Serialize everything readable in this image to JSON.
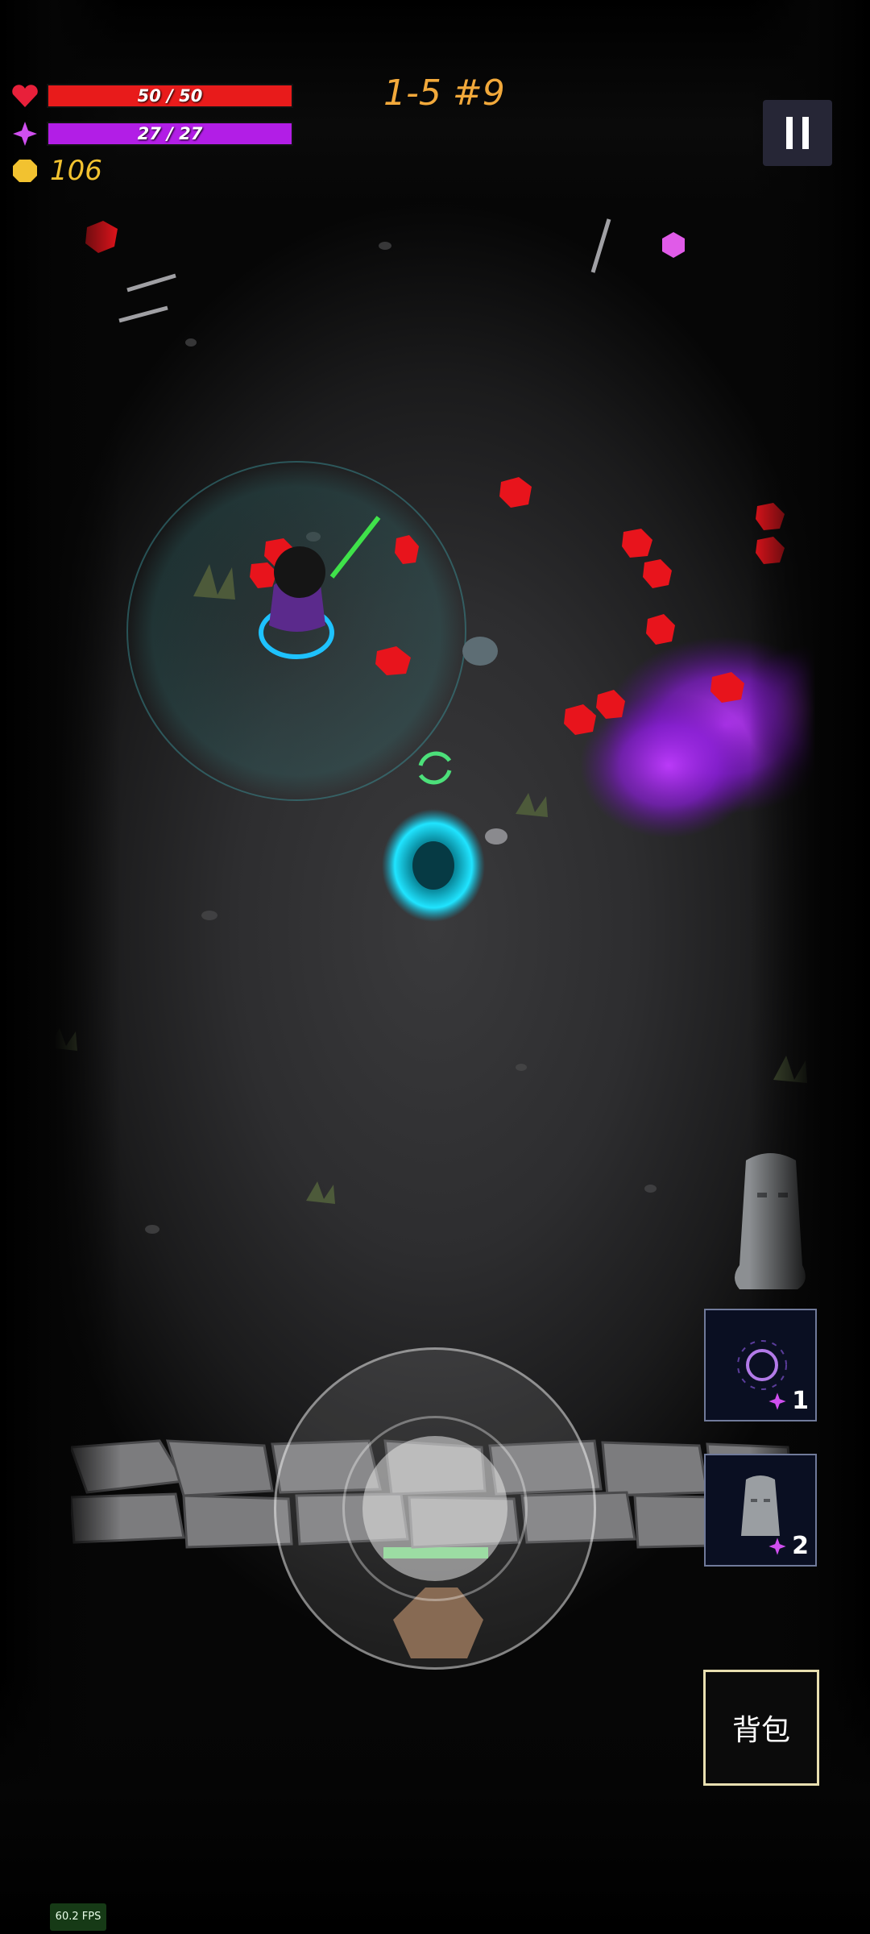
{
  "hud": {
    "health": {
      "label": "50 / 50",
      "current": 50,
      "max": 50,
      "color": "#e81b1b"
    },
    "mana": {
      "label": "27 / 27",
      "current": 27,
      "max": 27,
      "color": "#b21ee6"
    },
    "gold": {
      "value": "106",
      "color": "#f2c230"
    },
    "level": "1-5 #9"
  },
  "skills": [
    {
      "name": "vortex-skill",
      "cost": "1"
    },
    {
      "name": "statue-skill",
      "cost": "2"
    }
  ],
  "bag": {
    "label": "背包"
  },
  "fps": {
    "label": "60.2 FPS"
  },
  "icons": [
    "heart-icon",
    "mana-gem-icon",
    "gold-coin-icon",
    "pause-icon"
  ]
}
